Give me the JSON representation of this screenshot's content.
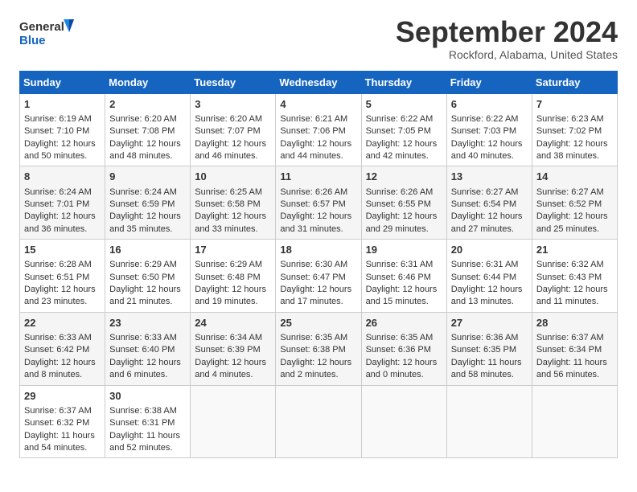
{
  "logo": {
    "line1": "General",
    "line2": "Blue"
  },
  "title": "September 2024",
  "location": "Rockford, Alabama, United States",
  "days_of_week": [
    "Sunday",
    "Monday",
    "Tuesday",
    "Wednesday",
    "Thursday",
    "Friday",
    "Saturday"
  ],
  "weeks": [
    [
      {
        "day": "1",
        "info": "Sunrise: 6:19 AM\nSunset: 7:10 PM\nDaylight: 12 hours\nand 50 minutes."
      },
      {
        "day": "2",
        "info": "Sunrise: 6:20 AM\nSunset: 7:08 PM\nDaylight: 12 hours\nand 48 minutes."
      },
      {
        "day": "3",
        "info": "Sunrise: 6:20 AM\nSunset: 7:07 PM\nDaylight: 12 hours\nand 46 minutes."
      },
      {
        "day": "4",
        "info": "Sunrise: 6:21 AM\nSunset: 7:06 PM\nDaylight: 12 hours\nand 44 minutes."
      },
      {
        "day": "5",
        "info": "Sunrise: 6:22 AM\nSunset: 7:05 PM\nDaylight: 12 hours\nand 42 minutes."
      },
      {
        "day": "6",
        "info": "Sunrise: 6:22 AM\nSunset: 7:03 PM\nDaylight: 12 hours\nand 40 minutes."
      },
      {
        "day": "7",
        "info": "Sunrise: 6:23 AM\nSunset: 7:02 PM\nDaylight: 12 hours\nand 38 minutes."
      }
    ],
    [
      {
        "day": "8",
        "info": "Sunrise: 6:24 AM\nSunset: 7:01 PM\nDaylight: 12 hours\nand 36 minutes."
      },
      {
        "day": "9",
        "info": "Sunrise: 6:24 AM\nSunset: 6:59 PM\nDaylight: 12 hours\nand 35 minutes."
      },
      {
        "day": "10",
        "info": "Sunrise: 6:25 AM\nSunset: 6:58 PM\nDaylight: 12 hours\nand 33 minutes."
      },
      {
        "day": "11",
        "info": "Sunrise: 6:26 AM\nSunset: 6:57 PM\nDaylight: 12 hours\nand 31 minutes."
      },
      {
        "day": "12",
        "info": "Sunrise: 6:26 AM\nSunset: 6:55 PM\nDaylight: 12 hours\nand 29 minutes."
      },
      {
        "day": "13",
        "info": "Sunrise: 6:27 AM\nSunset: 6:54 PM\nDaylight: 12 hours\nand 27 minutes."
      },
      {
        "day": "14",
        "info": "Sunrise: 6:27 AM\nSunset: 6:52 PM\nDaylight: 12 hours\nand 25 minutes."
      }
    ],
    [
      {
        "day": "15",
        "info": "Sunrise: 6:28 AM\nSunset: 6:51 PM\nDaylight: 12 hours\nand 23 minutes."
      },
      {
        "day": "16",
        "info": "Sunrise: 6:29 AM\nSunset: 6:50 PM\nDaylight: 12 hours\nand 21 minutes."
      },
      {
        "day": "17",
        "info": "Sunrise: 6:29 AM\nSunset: 6:48 PM\nDaylight: 12 hours\nand 19 minutes."
      },
      {
        "day": "18",
        "info": "Sunrise: 6:30 AM\nSunset: 6:47 PM\nDaylight: 12 hours\nand 17 minutes."
      },
      {
        "day": "19",
        "info": "Sunrise: 6:31 AM\nSunset: 6:46 PM\nDaylight: 12 hours\nand 15 minutes."
      },
      {
        "day": "20",
        "info": "Sunrise: 6:31 AM\nSunset: 6:44 PM\nDaylight: 12 hours\nand 13 minutes."
      },
      {
        "day": "21",
        "info": "Sunrise: 6:32 AM\nSunset: 6:43 PM\nDaylight: 12 hours\nand 11 minutes."
      }
    ],
    [
      {
        "day": "22",
        "info": "Sunrise: 6:33 AM\nSunset: 6:42 PM\nDaylight: 12 hours\nand 8 minutes."
      },
      {
        "day": "23",
        "info": "Sunrise: 6:33 AM\nSunset: 6:40 PM\nDaylight: 12 hours\nand 6 minutes."
      },
      {
        "day": "24",
        "info": "Sunrise: 6:34 AM\nSunset: 6:39 PM\nDaylight: 12 hours\nand 4 minutes."
      },
      {
        "day": "25",
        "info": "Sunrise: 6:35 AM\nSunset: 6:38 PM\nDaylight: 12 hours\nand 2 minutes."
      },
      {
        "day": "26",
        "info": "Sunrise: 6:35 AM\nSunset: 6:36 PM\nDaylight: 12 hours\nand 0 minutes."
      },
      {
        "day": "27",
        "info": "Sunrise: 6:36 AM\nSunset: 6:35 PM\nDaylight: 11 hours\nand 58 minutes."
      },
      {
        "day": "28",
        "info": "Sunrise: 6:37 AM\nSunset: 6:34 PM\nDaylight: 11 hours\nand 56 minutes."
      }
    ],
    [
      {
        "day": "29",
        "info": "Sunrise: 6:37 AM\nSunset: 6:32 PM\nDaylight: 11 hours\nand 54 minutes."
      },
      {
        "day": "30",
        "info": "Sunrise: 6:38 AM\nSunset: 6:31 PM\nDaylight: 11 hours\nand 52 minutes."
      },
      {
        "day": "",
        "info": ""
      },
      {
        "day": "",
        "info": ""
      },
      {
        "day": "",
        "info": ""
      },
      {
        "day": "",
        "info": ""
      },
      {
        "day": "",
        "info": ""
      }
    ]
  ]
}
